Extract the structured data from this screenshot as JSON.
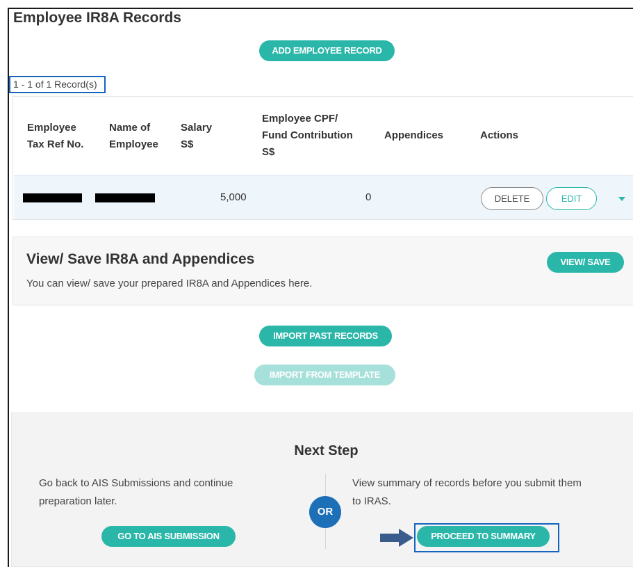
{
  "page": {
    "title": "Employee IR8A Records",
    "add_button": "ADD EMPLOYEE RECORD",
    "record_count": "1 - 1 of 1 Record(s)"
  },
  "table": {
    "headers": {
      "tax_ref_line1": "Employee",
      "tax_ref_line2": "Tax Ref No.",
      "name_line1": "Name of",
      "name_line2": "Employee",
      "salary_line1": "Salary",
      "salary_line2": "S$",
      "cpf_line1": "Employee CPF/",
      "cpf_line2": "Fund Contribution",
      "cpf_line3": "S$",
      "appendices": "Appendices",
      "actions": "Actions"
    },
    "rows": [
      {
        "salary": "5,000",
        "cpf": "0",
        "delete": "DELETE",
        "edit": "EDIT"
      }
    ]
  },
  "view_save": {
    "title": "View/ Save IR8A and Appendices",
    "subtitle": "You can view/ save your prepared IR8A and Appendices here.",
    "button": "VIEW/ SAVE"
  },
  "import": {
    "past_records": "IMPORT PAST RECORDS",
    "from_template": "IMPORT FROM TEMPLATE"
  },
  "next_step": {
    "title": "Next Step",
    "left_line1": "Go back to AIS Submissions and continue",
    "left_line2": "preparation later.",
    "left_button": "GO TO AIS SUBMISSION",
    "or": "OR",
    "right_line1": "View summary of records before you submit them",
    "right_line2": "to IRAS.",
    "right_button": "PROCEED TO SUMMARY"
  },
  "colors": {
    "accent": "#2ab7a9",
    "accent_disabled": "#a6e0da",
    "highlight": "#1565c0",
    "or_badge": "#1d6fb8"
  }
}
